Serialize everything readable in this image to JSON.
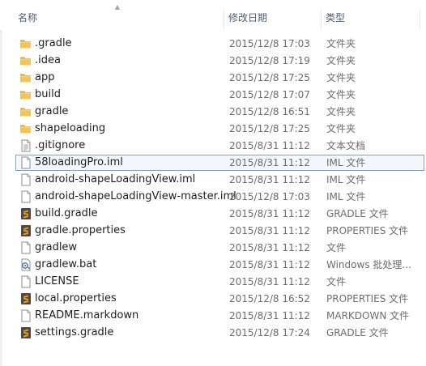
{
  "columns": {
    "name": "名称",
    "date": "修改日期",
    "type": "类型",
    "sort_indicator": "▲"
  },
  "files": [
    {
      "name": ".gradle",
      "date": "2015/12/8 17:03",
      "type": "文件夹",
      "icon": "folder-icon"
    },
    {
      "name": ".idea",
      "date": "2015/12/8 17:19",
      "type": "文件夹",
      "icon": "folder-icon"
    },
    {
      "name": "app",
      "date": "2015/12/8 17:25",
      "type": "文件夹",
      "icon": "folder-icon"
    },
    {
      "name": "build",
      "date": "2015/12/8 17:07",
      "type": "文件夹",
      "icon": "folder-icon"
    },
    {
      "name": "gradle",
      "date": "2015/12/8 16:51",
      "type": "文件夹",
      "icon": "folder-icon"
    },
    {
      "name": "shapeloading",
      "date": "2015/12/8 17:25",
      "type": "文件夹",
      "icon": "folder-icon"
    },
    {
      "name": ".gitignore",
      "date": "2015/8/31 11:12",
      "type": "文本文档",
      "icon": "text-file-icon"
    },
    {
      "name": "58loadingPro.iml",
      "date": "2015/8/31 11:12",
      "type": "IML 文件",
      "icon": "file-icon",
      "selected": true
    },
    {
      "name": "android-shapeLoadingView.iml",
      "date": "2015/8/31 11:12",
      "type": "IML 文件",
      "icon": "file-icon"
    },
    {
      "name": "android-shapeLoadingView-master.iml",
      "date": "2015/12/8 17:03",
      "type": "IML 文件",
      "icon": "file-icon"
    },
    {
      "name": "build.gradle",
      "date": "2015/8/31 11:12",
      "type": "GRADLE 文件",
      "icon": "sublime-file-icon"
    },
    {
      "name": "gradle.properties",
      "date": "2015/8/31 11:12",
      "type": "PROPERTIES 文件",
      "icon": "sublime-file-icon"
    },
    {
      "name": "gradlew",
      "date": "2015/8/31 11:12",
      "type": "文件",
      "icon": "file-icon"
    },
    {
      "name": "gradlew.bat",
      "date": "2015/8/31 11:12",
      "type": "Windows 批处理...",
      "icon": "batch-file-icon"
    },
    {
      "name": "LICENSE",
      "date": "2015/8/31 11:12",
      "type": "文件",
      "icon": "file-icon"
    },
    {
      "name": "local.properties",
      "date": "2015/12/8 16:52",
      "type": "PROPERTIES 文件",
      "icon": "sublime-file-icon"
    },
    {
      "name": "README.markdown",
      "date": "2015/8/31 11:12",
      "type": "MARKDOWN 文件",
      "icon": "file-icon"
    },
    {
      "name": "settings.gradle",
      "date": "2015/12/8 17:24",
      "type": "GRADLE 文件",
      "icon": "sublime-file-icon"
    }
  ],
  "colors": {
    "folder": "#e8b64a",
    "selection_border": "#7da2ce",
    "header_text": "#4c607a"
  }
}
